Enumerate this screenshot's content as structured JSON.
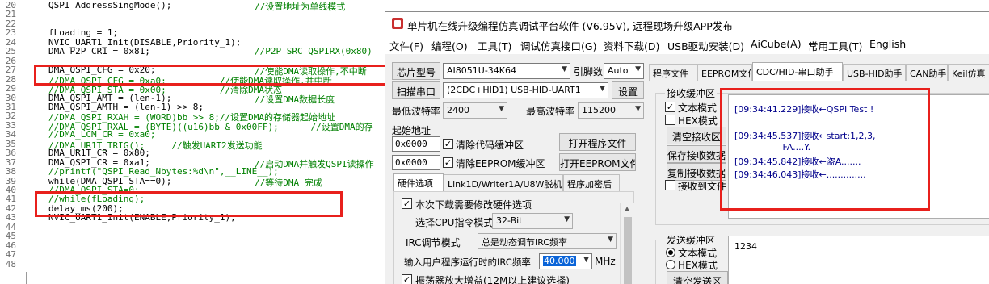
{
  "editor": {
    "line_numbers": [
      "20",
      "21",
      "22",
      "23",
      "24",
      "25",
      "26",
      "27",
      "28",
      "29",
      "30",
      "31",
      "32",
      "33",
      "34",
      "35",
      "36",
      "37",
      "38",
      "39",
      "40",
      "41",
      "42",
      "43",
      "44",
      "45",
      "46",
      "47",
      "48"
    ],
    "lines": [
      {
        "code": "QSPI_AddressSingMode();",
        "comment": "//设置地址为单线模式"
      },
      {
        "code": "",
        "comment": ""
      },
      {
        "code": "",
        "comment": ""
      },
      {
        "code": "fLoading = 1;",
        "comment": ""
      },
      {
        "code": "NVIC_UART1_Init(DISABLE,Priority_1);",
        "comment": ""
      },
      {
        "code": "DMA_P2P_CR1 = 0x81;",
        "comment": "//P2P_SRC_QSPIRX(0x80)"
      },
      {
        "code": "",
        "comment": ""
      },
      {
        "code": "DMA_QSPI_CFG = 0x20;",
        "comment": "//使能DMA读取操作,不中断"
      },
      {
        "code": "",
        "comment": "//DMA_QSPI_CFG = 0xa0;          //使能DMA读取操作,并中断"
      },
      {
        "code": "",
        "comment": "//DMA_QSPI_STA = 0x00;          //清除DMA状态"
      },
      {
        "code": "DMA_QSPI_AMT = (len-1);",
        "comment": "//设置DMA数据长度"
      },
      {
        "code": "DMA_QSPI_AMTH = (len-1) >> 8;",
        "comment": ""
      },
      {
        "code": "",
        "comment": "//DMA_QSPI_RXAH = (WORD)bb >> 8;//设置DMA的存储器起始地址"
      },
      {
        "code": "",
        "comment": "//DMA_QSPI_RXAL = (BYTE)((u16)bb & 0x00FF);      //设置DMA的存"
      },
      {
        "code": "",
        "comment": "//DMA_LCM_CR = 0xa0;"
      },
      {
        "code": "",
        "comment": "//DMA_UR1T_TRIG();     //触发UART2发送功能"
      },
      {
        "code": "DMA_UR1T_CR = 0x80;",
        "comment": ""
      },
      {
        "code": "DMA_QSPI_CR = 0xa1;",
        "comment": "//启动DMA并触发QSPI读操作"
      },
      {
        "code": "",
        "comment": "//printf(\"QSPI_Read_Nbytes:%d\\n\",__LINE__);"
      },
      {
        "code": "while(DMA_QSPI_STA==0);",
        "comment": "//等待DMA 完成"
      },
      {
        "code": "",
        "comment": "//DMA_QSPI_STA=0;"
      },
      {
        "code": "",
        "comment": "//while(fLoading);"
      },
      {
        "code": "delay_ms(200);",
        "comment": ""
      },
      {
        "code": "NVIC_UART1_Init(ENABLE,Priority_1);",
        "comment": ""
      },
      {
        "code": "",
        "comment": ""
      },
      {
        "code": "",
        "comment": ""
      },
      {
        "code": "",
        "comment": ""
      },
      {
        "code": "",
        "comment": ""
      },
      {
        "code": "",
        "comment": ""
      }
    ]
  },
  "window": {
    "title": "单片机在线升级编程仿真调试平台软件 (V6.95V), 远程现场升级APP发布",
    "menus": [
      "文件(F)",
      "编程(O)",
      "工具(T)",
      "调试仿真接口(G)",
      "资料下载(D)",
      "USB驱动安装(D)",
      "AiCube(A)",
      "常用工具(T)",
      "English"
    ]
  },
  "left_panel": {
    "chip_button": "芯片型号",
    "chip_value": "AI8051U-34K64",
    "pins_label": "引脚数",
    "pins_value": "Auto",
    "scan_button": "扫描串口",
    "port_value": "(2CDC+HID1) USB-HID-UART1",
    "settings_button": "设置",
    "min_baud_label": "最低波特率",
    "min_baud_value": "2400",
    "max_baud_label": "最高波特率",
    "max_baud_value": "115200",
    "start_addr_label": "起始地址",
    "addr1_value": "0x0000",
    "clear_code_label": "清除代码缓冲区",
    "open_program_button": "打开程序文件",
    "addr2_value": "0x0000",
    "clear_eeprom_label": "清除EEPROM缓冲区",
    "open_eeprom_button": "打开EEPROM文件",
    "tabs": [
      "硬件选项",
      "Link1D/Writer1A/U8W脱机",
      "程序加密后"
    ],
    "hw_change_label": "本次下载需要修改硬件选项",
    "cpu_mode_label": "选择CPU指令模式",
    "cpu_mode_value": "32-Bit",
    "irc_mode_label": "IRC调节模式",
    "irc_mode_value": "总是动态调节IRC频率",
    "irc_freq_label": "输入用户程序运行时的IRC频率",
    "irc_freq_value": "40.000",
    "irc_freq_unit": "MHz",
    "osc_label": "振荡器放大增益(12M以上建议选择)"
  },
  "right_panel": {
    "tabs": [
      "程序文件",
      "EEPROM文件",
      "CDC/HID-串口助手",
      "USB-HID助手",
      "CAN助手",
      "Keil仿真"
    ],
    "recv_group_label": "接收缓冲区",
    "text_mode_label": "文本模式",
    "hex_mode_label": "HEX模式",
    "clear_recv_button": "清空接收区",
    "save_recv_button": "保存接收数据",
    "copy_recv_button": "复制接收数据",
    "recv_to_file_label": "接收到文件",
    "recv_lines": [
      "[09:34:41.229]接收←QSPI Test !",
      "",
      "[09:34:45.537]接收←start:1,2,3,",
      "                 FA....Y.",
      "[09:34:45.842]接收←盗A.......",
      "[09:34:46.043]接收←.............."
    ],
    "send_group_label": "发送缓冲区",
    "send_text_mode_label": "文本模式",
    "send_hex_mode_label": "HEX模式",
    "clear_send_button": "清空发送区",
    "send_value": "1234"
  },
  "colors": {
    "highlight": "#e8201c",
    "comment": "#008000",
    "recv_text": "#00008b"
  }
}
